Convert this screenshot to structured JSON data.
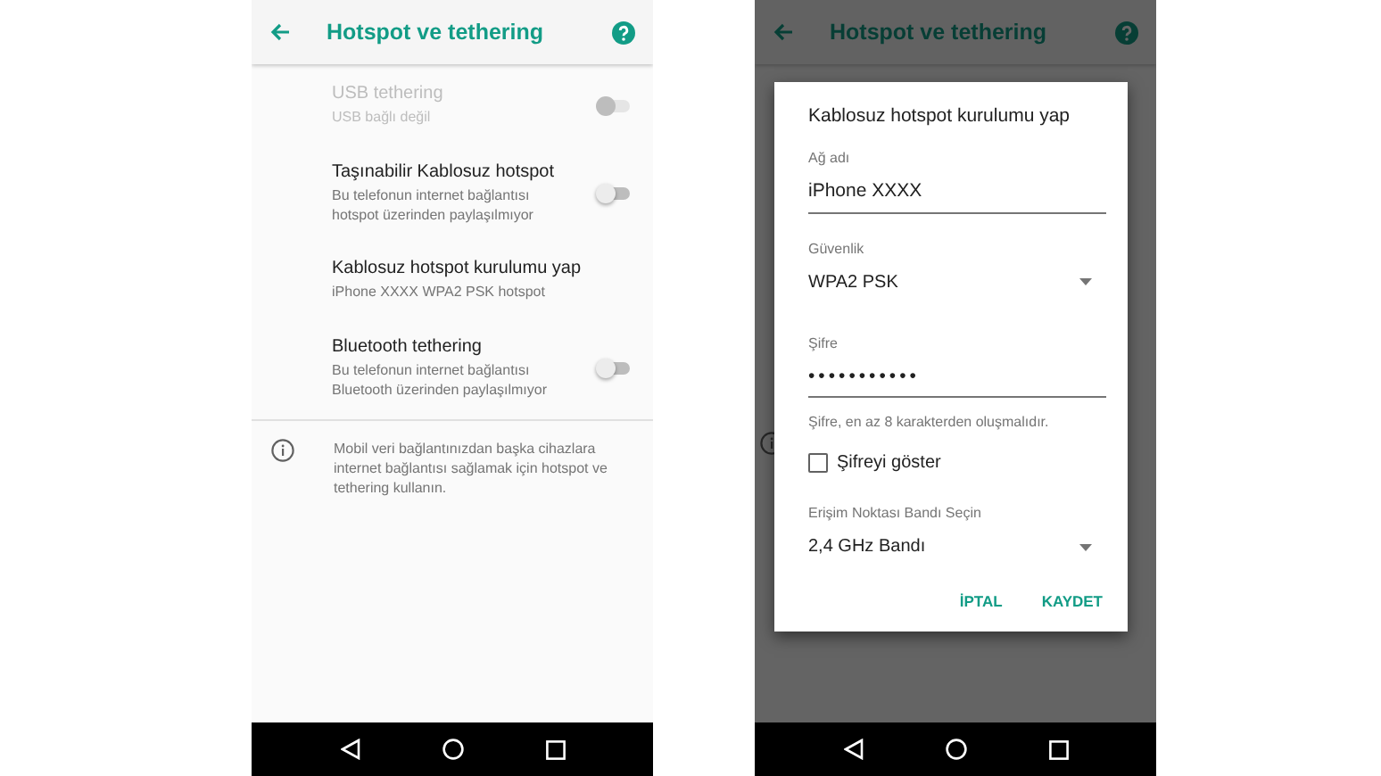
{
  "settings_screen": {
    "app_bar": {
      "title": "Hotspot ve tethering"
    },
    "items": [
      {
        "kind": "switch",
        "title": "USB tethering",
        "subtitle": "USB bağlı değil",
        "on": false,
        "disabled": true
      },
      {
        "kind": "switch",
        "title": "Taşınabilir Kablosuz hotspot",
        "subtitle": "Bu telefonun internet bağlantısı hotspot üzerinden paylaşılmıyor",
        "on": false,
        "disabled": false
      },
      {
        "kind": "link",
        "title": "Kablosuz hotspot kurulumu yap",
        "subtitle": "iPhone XXXX WPA2 PSK hotspot",
        "disabled": false
      },
      {
        "kind": "switch",
        "title": "Bluetooth tethering",
        "subtitle": "Bu telefonun internet bağlantısı Bluetooth üzerinden paylaşılmıyor",
        "on": false,
        "disabled": false
      }
    ],
    "info_text": "Mobil veri bağlantınızdan başka cihazlara internet bağlantısı sağlamak için hotspot ve tethering kullanın."
  },
  "dialog_screen": {
    "app_bar": {
      "title": "Hotspot ve tethering"
    },
    "dialog": {
      "title": "Kablosuz hotspot kurulumu yap",
      "fields": [
        {
          "kind": "text",
          "label": "Ağ adı",
          "value": "iPhone XXXX"
        },
        {
          "kind": "select",
          "label": "Güvenlik",
          "value": "WPA2 PSK"
        },
        {
          "kind": "password",
          "label": "Şifre",
          "value": "•••••••••••",
          "hint": "Şifre, en az 8 karakterden oluşmalıdır."
        },
        {
          "kind": "checkbox",
          "label": "Şifreyi göster",
          "checked": false
        },
        {
          "kind": "select",
          "label": "Erişim Noktası Bandı Seçin",
          "value": "2,4 GHz Bandı"
        }
      ],
      "buttons": [
        "İPTAL",
        "KAYDET"
      ]
    }
  }
}
